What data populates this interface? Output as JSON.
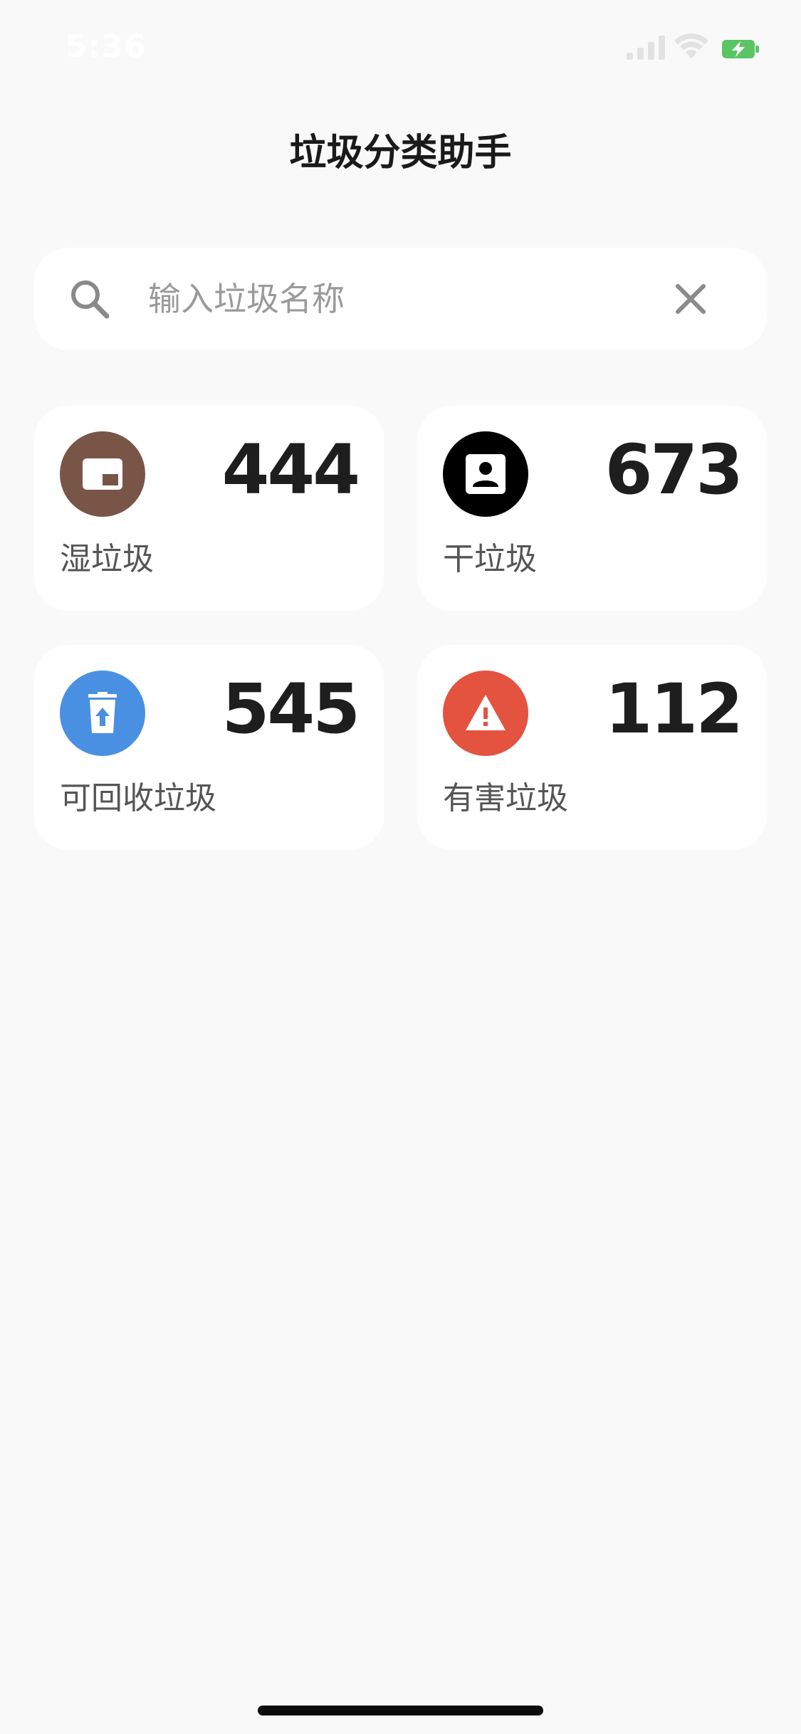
{
  "status_bar": {
    "time": "5:36",
    "battery_color": "#5bc564"
  },
  "header": {
    "title": "垃圾分类助手"
  },
  "search": {
    "placeholder": "输入垃圾名称",
    "value": "",
    "icon": "search-icon",
    "clear_icon": "close-icon"
  },
  "categories": [
    {
      "label": "湿垃圾",
      "count": "444",
      "icon": "kitchen-waste-icon",
      "color": "#795548"
    },
    {
      "label": "干垃圾",
      "count": "673",
      "icon": "residual-waste-icon",
      "color": "#000000"
    },
    {
      "label": "可回收垃圾",
      "count": "545",
      "icon": "recycle-bin-icon",
      "color": "#4a90e2"
    },
    {
      "label": "有害垃圾",
      "count": "112",
      "icon": "warning-icon",
      "color": "#e35340"
    }
  ]
}
